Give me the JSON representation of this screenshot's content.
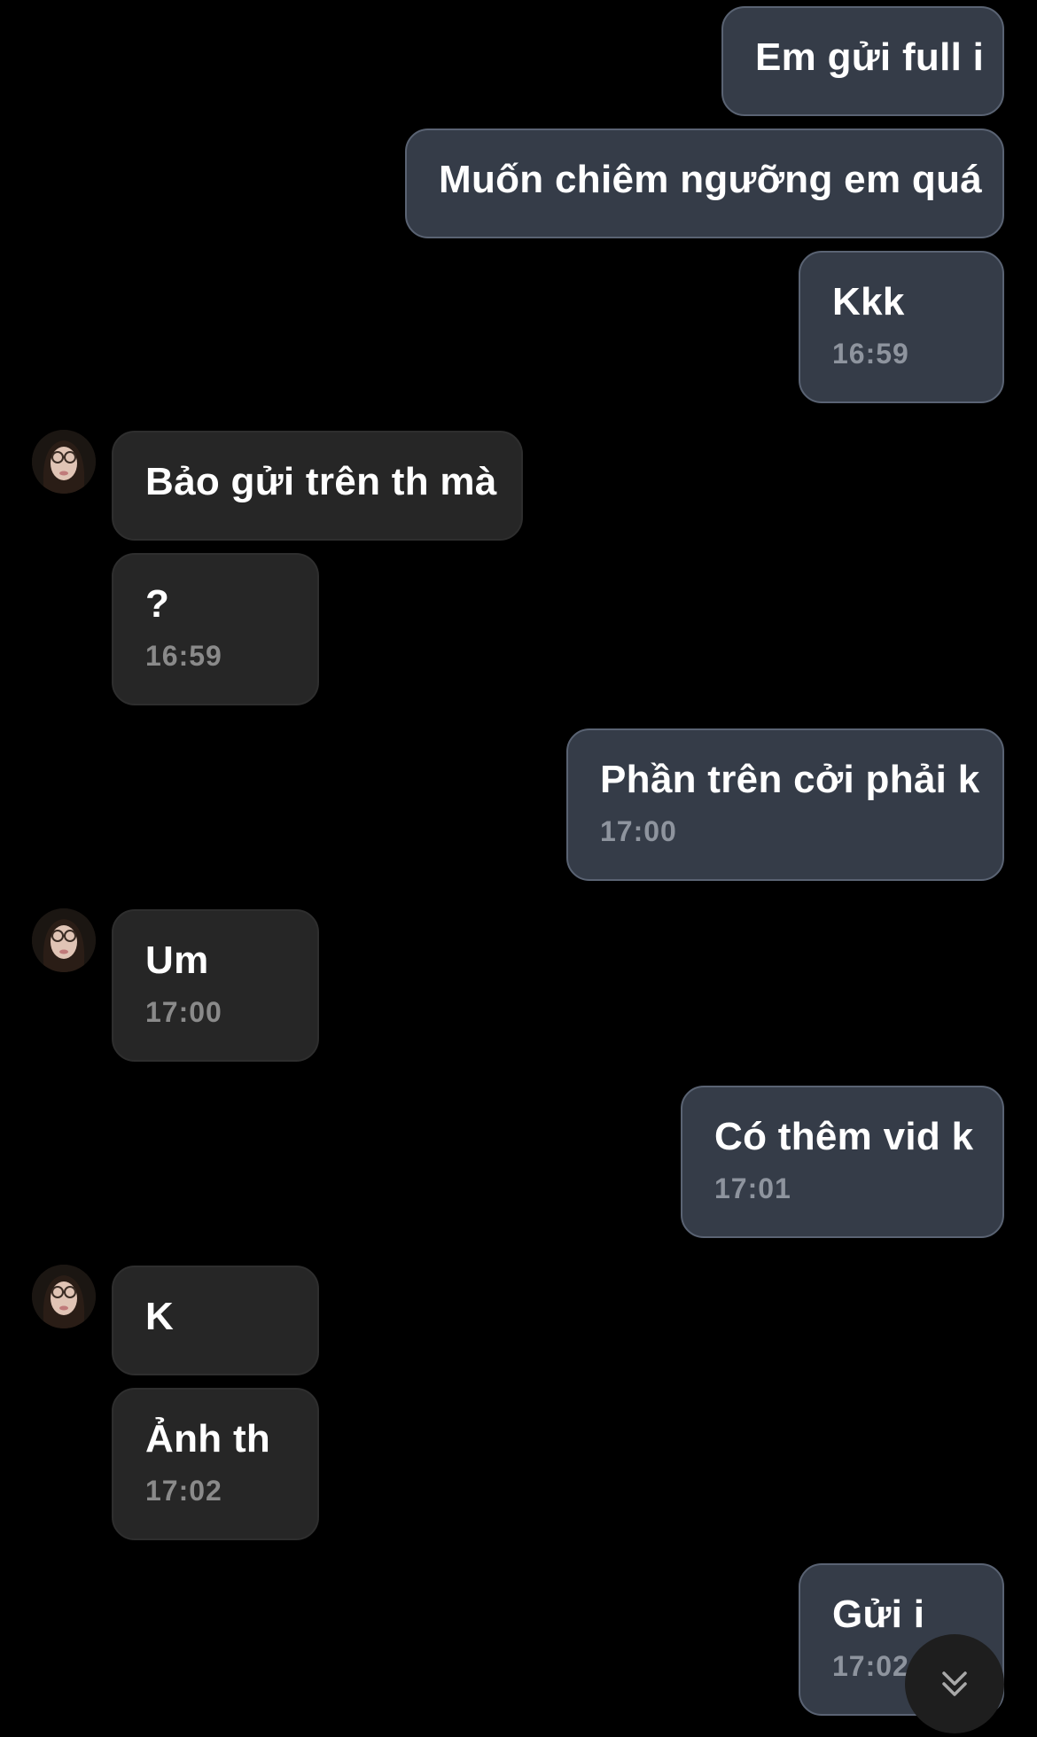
{
  "messages": [
    {
      "text": "Em gửi full i",
      "time": ""
    },
    {
      "text": "Muốn chiêm ngưỡng em quá",
      "time": ""
    },
    {
      "text": "Kkk",
      "time": "16:59"
    },
    {
      "text": "Bảo gửi trên th mà",
      "time": ""
    },
    {
      "text": "?",
      "time": "16:59"
    },
    {
      "text": "Phần trên cởi phải k",
      "time": "17:00"
    },
    {
      "text": "Um",
      "time": "17:00"
    },
    {
      "text": "Có thêm vid k",
      "time": "17:01"
    },
    {
      "text": "K",
      "time": ""
    },
    {
      "text": "Ảnh th",
      "time": "17:02"
    },
    {
      "text": "Gửi i",
      "time": "17:02"
    }
  ],
  "icons": {
    "avatar": "contact-avatar",
    "scroll_down": "double-chevron-down-icon"
  },
  "colors": {
    "background": "#000000",
    "outgoing_bubble": "#353c48",
    "incoming_bubble": "#262626",
    "timestamp": "#8e949e"
  }
}
